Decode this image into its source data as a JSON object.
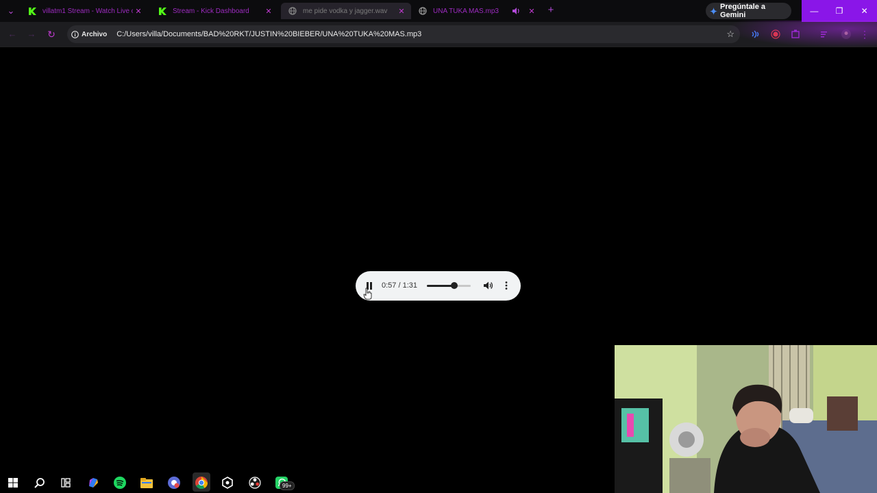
{
  "browser": {
    "tabs": [
      {
        "title": "villatm1 Stream - Watch Live o",
        "icon": "kick-icon",
        "close": "✕"
      },
      {
        "title": "Stream - Kick Dashboard",
        "icon": "kick-icon",
        "close": "✕"
      },
      {
        "title": "me pide vodka y jagger.wav",
        "icon": "globe-icon",
        "close": "✕"
      },
      {
        "title": "UNA TUKA MAS.mp3",
        "icon": "globe-icon",
        "close": "✕",
        "audio_icon": "speaker-icon"
      }
    ],
    "new_tab": "+",
    "gemini_label": "Pregúntale a Gemini",
    "window_controls": {
      "minimize": "—",
      "restore": "❐",
      "close": "✕"
    },
    "address": {
      "chip_label": "Archivo",
      "url": "C:/Users/villa/Documents/BAD%20RKT/JUSTIN%20BIEBER/UNA%20TUKA%20MAS.mp3"
    }
  },
  "player": {
    "time": "0:57 / 1:31",
    "progress": 0.626,
    "state": "playing"
  },
  "colors": {
    "accent": "#8a16e8",
    "tab_text_purple": "#9d2bc0",
    "kick_green": "#53fc18",
    "player_bg": "#f1f3f4"
  },
  "taskbar": {
    "badge": "99+",
    "icons": [
      "windows-icon",
      "search-icon",
      "task-view-icon",
      "copilot-icon",
      "spotify-icon",
      "file-explorer-icon",
      "chrome-profile-icon",
      "chrome-icon",
      "app-icon",
      "obs-icon",
      "whatsapp-icon"
    ]
  }
}
